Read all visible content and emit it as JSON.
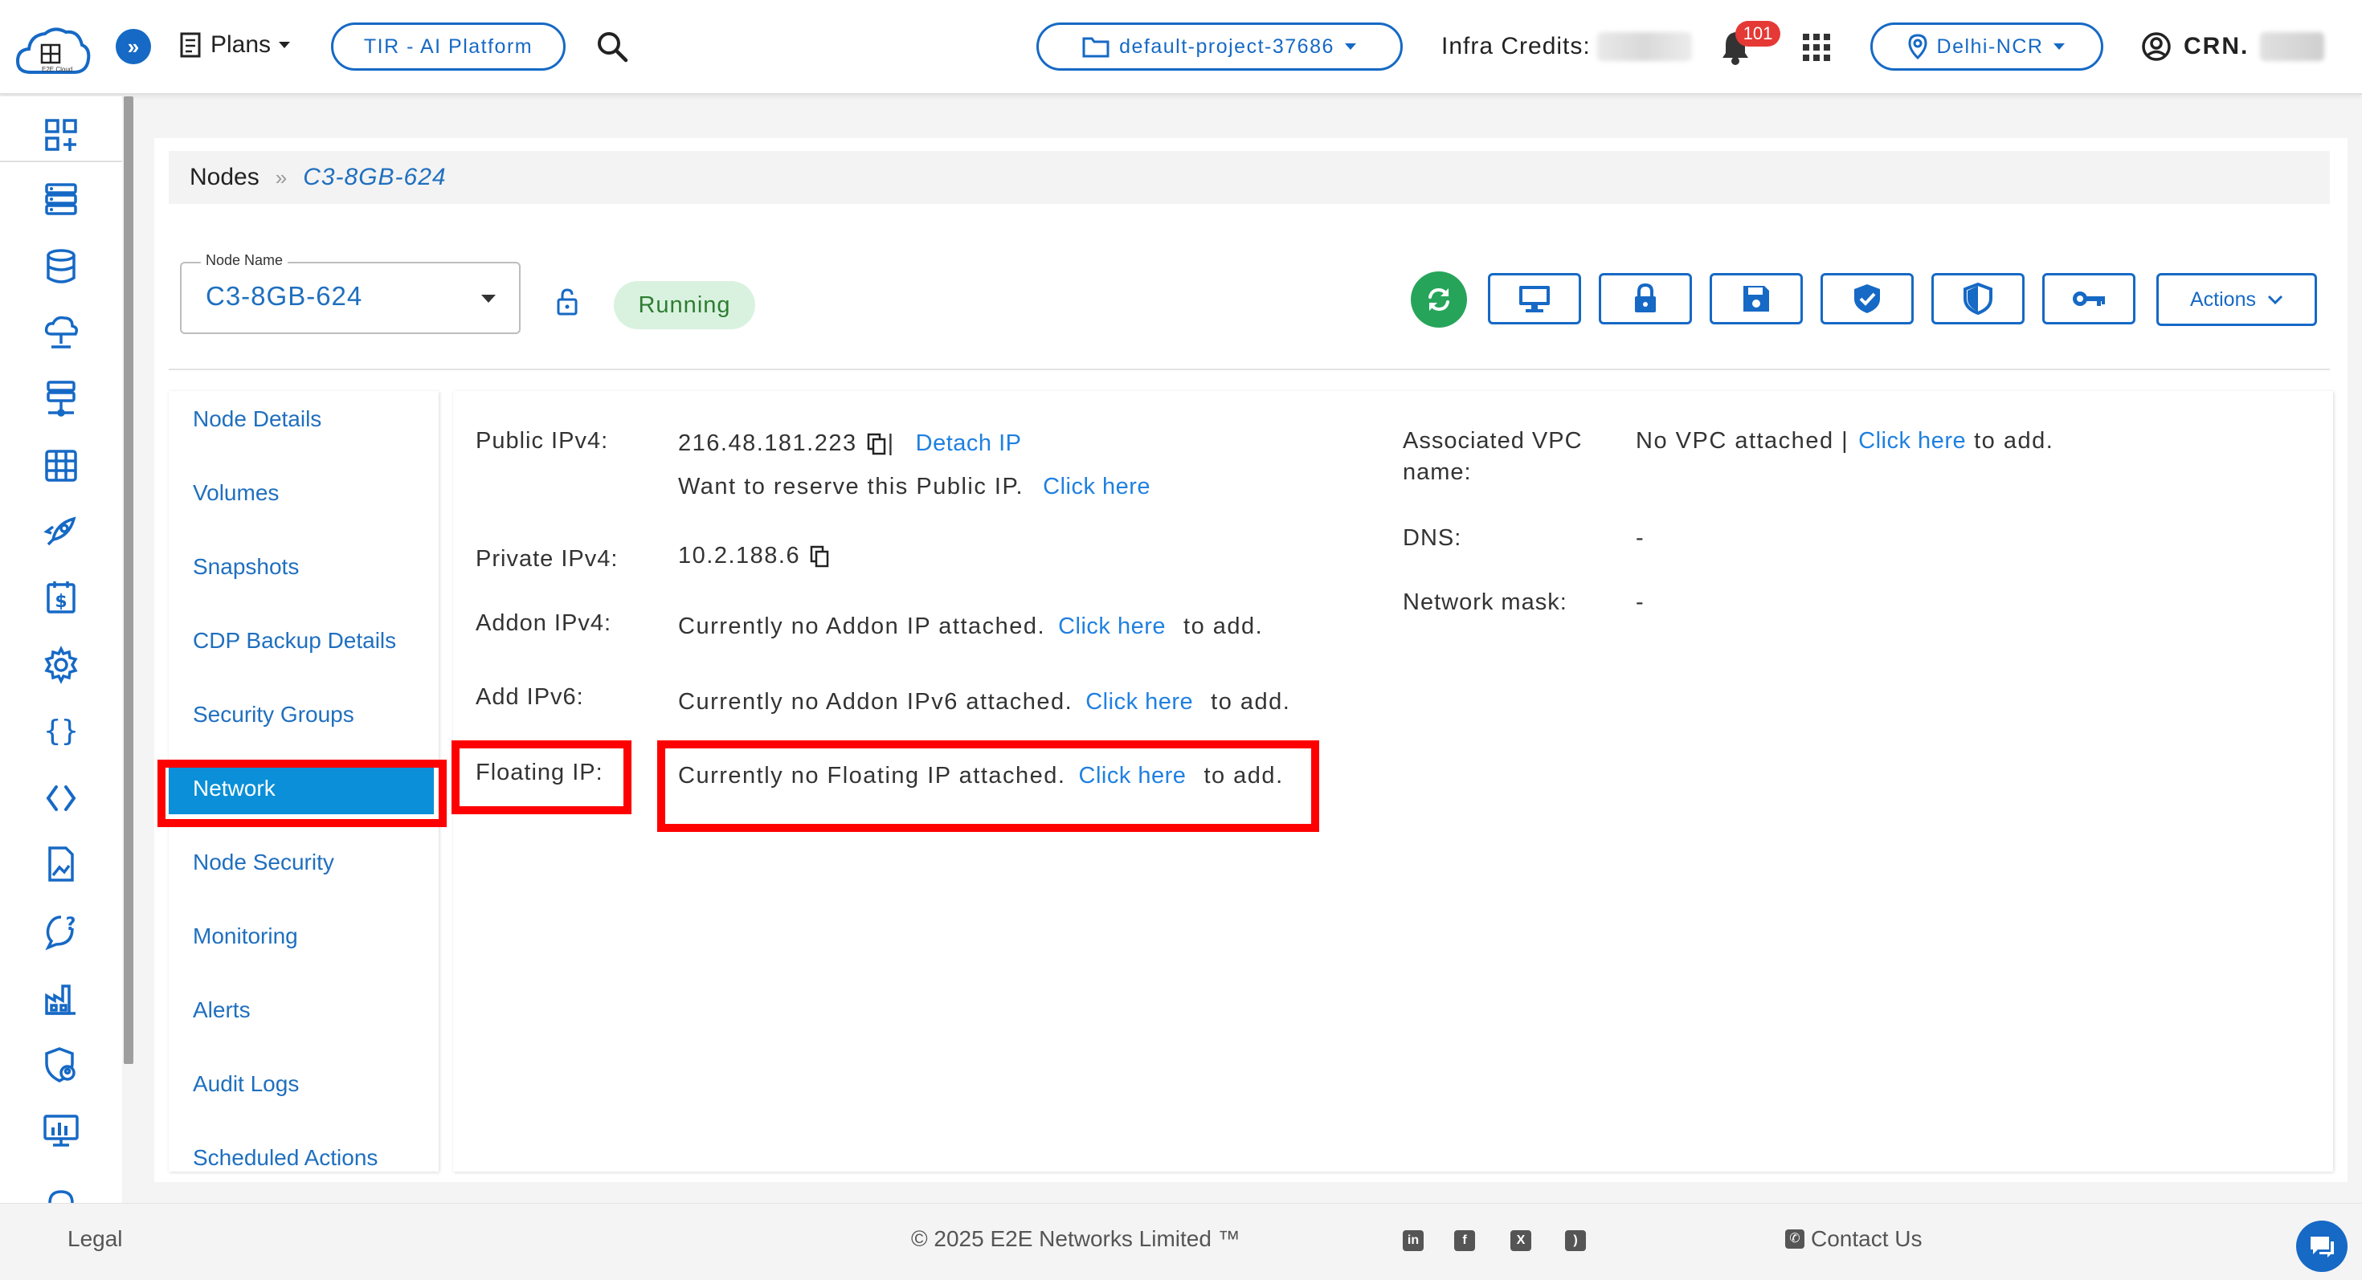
{
  "topbar": {
    "logo_text": "E2E Cloud",
    "plans_label": "Plans",
    "tir_label": "TIR - AI Platform",
    "project_label": "default-project-37686",
    "infra_credits_label": "Infra Credits:",
    "notification_count": "101",
    "region_label": "Delhi-NCR",
    "user_label": "CRN. "
  },
  "breadcrumb": {
    "root": "Nodes",
    "separator": "»",
    "current": "C3-8GB-624"
  },
  "node": {
    "select_label": "Node Name",
    "select_value": "C3-8GB-624",
    "status": "Running",
    "actions_label": "Actions"
  },
  "tabs": [
    {
      "label": "Node Details"
    },
    {
      "label": "Volumes"
    },
    {
      "label": "Snapshots"
    },
    {
      "label": "CDP Backup Details"
    },
    {
      "label": "Security Groups"
    },
    {
      "label": "Network"
    },
    {
      "label": "Node Security"
    },
    {
      "label": "Monitoring"
    },
    {
      "label": "Alerts"
    },
    {
      "label": "Audit Logs"
    },
    {
      "label": "Scheduled Actions"
    }
  ],
  "network": {
    "public_ipv4_label": "Public IPv4:",
    "public_ipv4_value": "216.48.181.223",
    "pipe": "|",
    "detach_ip": "Detach IP",
    "reserve_text": "Want to reserve this Public IP.",
    "reserve_link": "Click here",
    "private_ipv4_label": "Private IPv4:",
    "private_ipv4_value": "10.2.188.6",
    "addon_ipv4_label": "Addon IPv4:",
    "addon_ipv4_text": "Currently no Addon IP attached.",
    "addon_ipv4_link": "Click here",
    "addon_ipv4_suffix": "to add.",
    "add_ipv6_label": "Add IPv6:",
    "add_ipv6_text": "Currently no Addon IPv6 attached.",
    "add_ipv6_link": "Click here",
    "add_ipv6_suffix": "to add.",
    "floating_ip_label": "Floating IP:",
    "floating_ip_text": "Currently no Floating IP attached.",
    "floating_ip_link": "Click here",
    "floating_ip_suffix": "to add.",
    "vpc_label_1": "Associated VPC",
    "vpc_label_2": "name:",
    "vpc_text": "No VPC attached |",
    "vpc_link": "Click here",
    "vpc_suffix": "to add.",
    "dns_label": "DNS:",
    "dns_value": "-",
    "mask_label": "Network mask:",
    "mask_value": "-"
  },
  "footer": {
    "legal": "Legal",
    "copyright": "© 2025 E2E Networks Limited ™",
    "contact": "Contact Us"
  },
  "colors": {
    "accent": "#1669c5",
    "link": "#1f80e0",
    "active_tab": "#0a8fd8",
    "status_bg": "#d9f2df",
    "highlight": "#ff0000"
  }
}
